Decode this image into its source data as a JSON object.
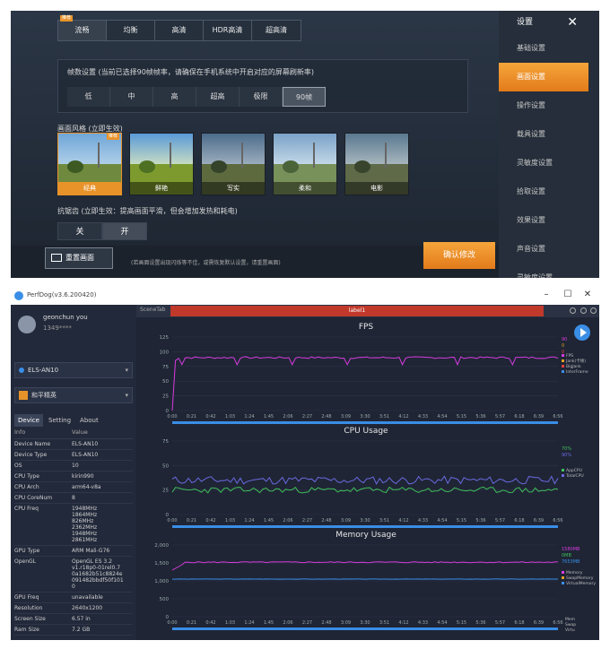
{
  "game": {
    "quality_tabs": [
      "流畅",
      "均衡",
      "高清",
      "HDR高清",
      "超高清"
    ],
    "recommend_badge": "推荐",
    "fps_label": "帧数设置 (当前已选择90帧帧率，请确保在手机系统中开启对应的屏幕刷新率)",
    "fps_tabs": [
      "低",
      "中",
      "高",
      "超高",
      "极限",
      "90帧"
    ],
    "style_label": "画面风格 (立即生效)",
    "styles": [
      "经典",
      "鲜艳",
      "写实",
      "柔和",
      "电影"
    ],
    "aa_label": "抗锯齿 (立即生效：提高画面平滑，但会增加发热和耗电)",
    "aa_options": [
      "关",
      "开"
    ],
    "reset_label": "重置画面",
    "hint": "(若画面设置出现闪烁等不佳，或需恢复默认设置，请重置画面)",
    "confirm_label": "确认修改",
    "side_title": "设置",
    "side_close": "✕",
    "side_items": [
      "基础设置",
      "画面设置",
      "操作设置",
      "载具设置",
      "灵敏度设置",
      "拾取设置",
      "效果设置",
      "声音设置",
      "灵敏度设置"
    ]
  },
  "perfdog": {
    "window_title": "PerfDog(v3.6.200420)",
    "user_name": "geonchun you",
    "user_id": "1349****",
    "device": "ELS-AN10",
    "app": "和平精英",
    "tabs": [
      "Device",
      "Setting",
      "About"
    ],
    "info_header": [
      "Info",
      "Value"
    ],
    "info_rows": [
      {
        "k": "Device Name",
        "v": "ELS-AN10"
      },
      {
        "k": "Device Type",
        "v": "ELS-AN10"
      },
      {
        "k": "OS",
        "v": "10"
      },
      {
        "k": "CPU Type",
        "v": "kirin990"
      },
      {
        "k": "CPU Arch",
        "v": "arm64-v8a"
      },
      {
        "k": "CPU CoreNum",
        "v": "8"
      },
      {
        "k": "CPU Freq",
        "v": "1948MHz\n1864MHz\n826MHz\n2362MHz\n1948MHz\n2861MHz"
      },
      {
        "k": "GPU Type",
        "v": "ARM Mali-G76"
      },
      {
        "k": "OpenGL",
        "v": "OpenGL ES 3.2\nv1.r18p0-01rel0.7\n0a1682b51c8824e\n091482bbdf50f101\n0"
      },
      {
        "k": "GPU Freq",
        "v": "unavailable"
      },
      {
        "k": "Resolution",
        "v": "2640x1200"
      },
      {
        "k": "Screen Size",
        "v": "6.57 in"
      },
      {
        "k": "Ram Size",
        "v": "7.2 GB"
      }
    ],
    "scene_label": "SceneTab",
    "label_bar": "label1",
    "fps_title": "FPS",
    "cpu_title": "CPU Usage",
    "mem_title": "Memory Usage",
    "fps_yticks": [
      "125",
      "100",
      "75",
      "50",
      "25",
      "0"
    ],
    "cpu_yticks": [
      "75",
      "50",
      "25",
      "0"
    ],
    "mem_yticks": [
      "2,000",
      "1,500",
      "1,000",
      "500",
      "0"
    ],
    "time_ticks": [
      "0:00",
      "0:21",
      "0:42",
      "1:03",
      "1:24",
      "1:45",
      "2:06",
      "2:27",
      "2:48",
      "3:09",
      "3:30",
      "3:51",
      "4:12",
      "4:33",
      "4:54",
      "5:15",
      "5:36",
      "5:57",
      "6:18",
      "6:39",
      "6:56"
    ],
    "fps_legend": [
      "FPS",
      "Jank(卡顿)",
      "BigJank",
      "InterFrame"
    ],
    "fps_vals": [
      "90",
      "0",
      "0"
    ],
    "cpu_legend": [
      "AppCPU",
      "TotalCPU"
    ],
    "cpu_vals": [
      "70%",
      "90%"
    ],
    "mem_legend": [
      "Memory",
      "SwapMemory",
      "VirtualMemory"
    ],
    "mem_vals": [
      "1580MB",
      "0MB",
      "7653MB"
    ],
    "mem_legend2": [
      "Mem",
      "Swap",
      "Virtu"
    ],
    "colors": {
      "fps": "#d63be0",
      "app_cpu": "#3fbf5a",
      "total_cpu": "#6a6ae0",
      "mem": "#d63be0",
      "virt": "#3a8ee6",
      "accent": "#e8932a"
    }
  }
}
